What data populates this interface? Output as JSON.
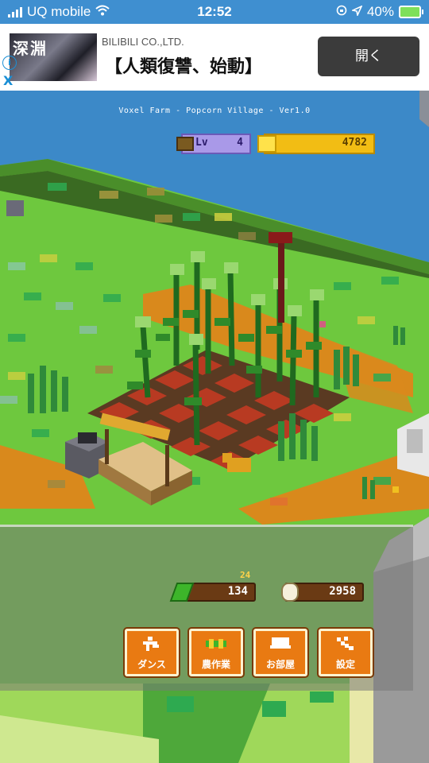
{
  "status_bar": {
    "carrier": "UQ mobile",
    "time": "12:52",
    "battery": "40%"
  },
  "ad": {
    "company": "BILIBILI CO.,LTD.",
    "title": "【人類復讐、始動】",
    "button": "開く",
    "thumb_text": "深淵",
    "info_symbol": "i",
    "close_symbol": "X"
  },
  "game": {
    "title": "Voxel Farm - Popcorn Village - Ver1.0",
    "level_label": "Lv",
    "level": "4",
    "corn_count": "4782",
    "sprout_count": "134",
    "sprout_badge": "24",
    "popcorn_count": "2958"
  },
  "menu": [
    {
      "label": "ダンス",
      "icon": "dance-icon"
    },
    {
      "label": "農作業",
      "icon": "farming-icon"
    },
    {
      "label": "お部屋",
      "icon": "room-icon"
    },
    {
      "label": "設定",
      "icon": "settings-icon"
    }
  ],
  "colors": {
    "water": "#3c89c8",
    "grass": "#6ec83e",
    "dirt": "#d9891c",
    "button_orange": "#e97a12",
    "corn_bar": "#f2bd14",
    "level_bar": "#a999e8"
  }
}
